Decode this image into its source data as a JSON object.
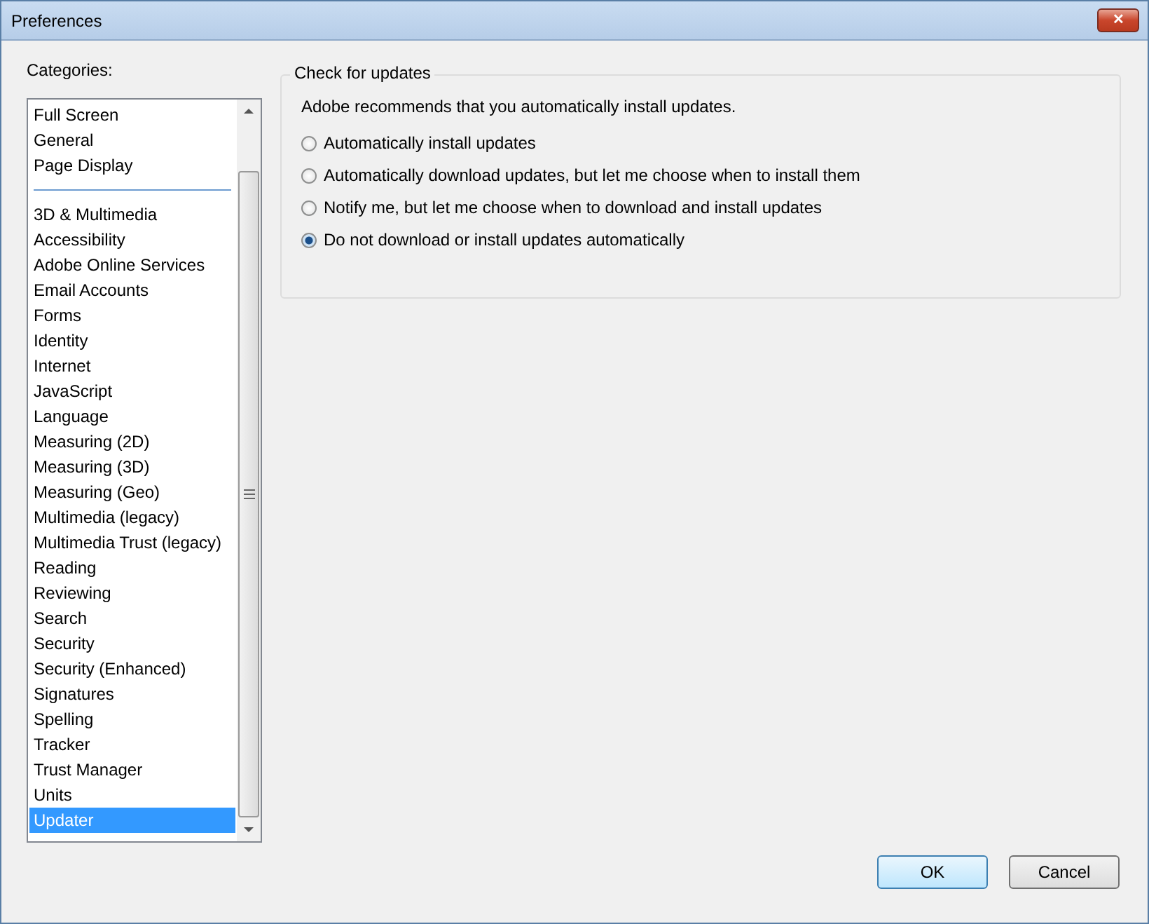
{
  "window": {
    "title": "Preferences",
    "close": "✕"
  },
  "categories_label": "Categories:",
  "pinned_categories": [
    {
      "label": "Full Screen",
      "selected": false
    },
    {
      "label": "General",
      "selected": false
    },
    {
      "label": "Page Display",
      "selected": false
    }
  ],
  "categories": [
    {
      "label": "3D & Multimedia",
      "selected": false
    },
    {
      "label": "Accessibility",
      "selected": false
    },
    {
      "label": "Adobe Online Services",
      "selected": false
    },
    {
      "label": "Email Accounts",
      "selected": false
    },
    {
      "label": "Forms",
      "selected": false
    },
    {
      "label": "Identity",
      "selected": false
    },
    {
      "label": "Internet",
      "selected": false
    },
    {
      "label": "JavaScript",
      "selected": false
    },
    {
      "label": "Language",
      "selected": false
    },
    {
      "label": "Measuring (2D)",
      "selected": false
    },
    {
      "label": "Measuring (3D)",
      "selected": false
    },
    {
      "label": "Measuring (Geo)",
      "selected": false
    },
    {
      "label": "Multimedia (legacy)",
      "selected": false
    },
    {
      "label": "Multimedia Trust (legacy)",
      "selected": false
    },
    {
      "label": "Reading",
      "selected": false
    },
    {
      "label": "Reviewing",
      "selected": false
    },
    {
      "label": "Search",
      "selected": false
    },
    {
      "label": "Security",
      "selected": false
    },
    {
      "label": "Security (Enhanced)",
      "selected": false
    },
    {
      "label": "Signatures",
      "selected": false
    },
    {
      "label": "Spelling",
      "selected": false
    },
    {
      "label": "Tracker",
      "selected": false
    },
    {
      "label": "Trust Manager",
      "selected": false
    },
    {
      "label": "Units",
      "selected": false
    },
    {
      "label": "Updater",
      "selected": true
    }
  ],
  "group": {
    "title": "Check for updates",
    "note": "Adobe recommends that you automatically install updates.",
    "options": [
      {
        "label": "Automatically install updates",
        "selected": false
      },
      {
        "label": "Automatically download updates, but let me choose when to install them",
        "selected": false
      },
      {
        "label": "Notify me, but let me choose when to download and install updates",
        "selected": false
      },
      {
        "label": "Do not download or install updates automatically",
        "selected": true
      }
    ]
  },
  "buttons": [
    {
      "label": "OK",
      "default": true
    },
    {
      "label": "Cancel",
      "default": false
    }
  ]
}
